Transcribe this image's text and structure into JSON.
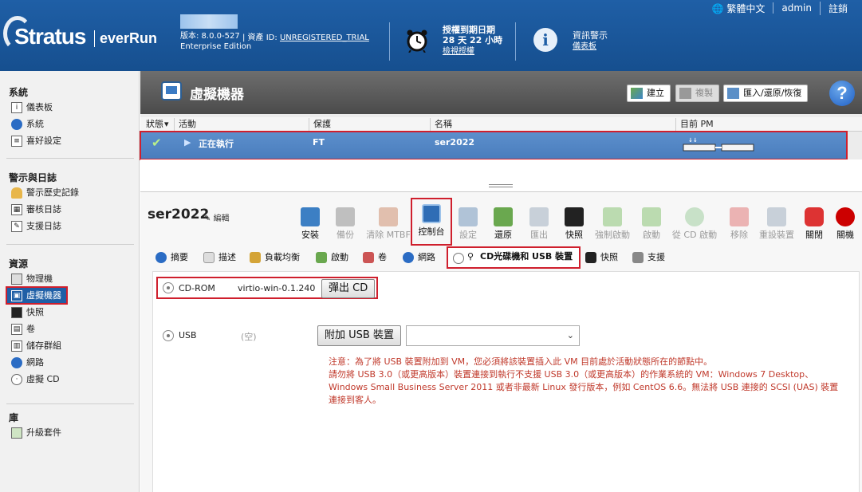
{
  "header": {
    "lang_label": "繁體中文",
    "user_label": "admin",
    "logout_label": "註銷",
    "brand": "Stratus",
    "product": "everRun",
    "version_label": "版本: 8.0.0-527",
    "edition_label": "Enterprise Edition",
    "asset_prefix": "| 資產 ID:",
    "asset_id": "UNREGISTERED_TRIAL",
    "license_title": "授權到期日期",
    "license_remaining": "28 天 22 小時",
    "license_link": "檢視授權",
    "alerts_title": "資訊警示",
    "alerts_link": "儀表板"
  },
  "sidebar": {
    "system_heading": "系統",
    "system_items": [
      {
        "label": "儀表板",
        "icon": "dashboard-icon"
      },
      {
        "label": "系統",
        "icon": "globe-icon"
      },
      {
        "label": "喜好設定",
        "icon": "preferences-icon"
      }
    ],
    "alerts_heading": "警示與日誌",
    "alerts_items": [
      {
        "label": "警示歷史記錄",
        "icon": "bell-icon"
      },
      {
        "label": "審核日誌",
        "icon": "calendar-icon"
      },
      {
        "label": "支援日誌",
        "icon": "log-icon"
      }
    ],
    "resources_heading": "資源",
    "resources_items": [
      {
        "label": "物理機",
        "icon": "server-icon"
      },
      {
        "label": "虛擬機器",
        "icon": "vm-icon"
      },
      {
        "label": "快照",
        "icon": "camera-icon"
      },
      {
        "label": "卷",
        "icon": "volume-icon"
      },
      {
        "label": "儲存群組",
        "icon": "storage-icon"
      },
      {
        "label": "網路",
        "icon": "network-icon"
      },
      {
        "label": "虛擬 CD",
        "icon": "cd-icon"
      }
    ],
    "library_heading": "庫",
    "library_items": [
      {
        "label": "升級套件",
        "icon": "upgrade-icon"
      }
    ]
  },
  "page": {
    "title": "虛擬機器",
    "create_label": "建立",
    "copy_label": "複製",
    "import_label": "匯入/還原/恢復",
    "help_label": "?"
  },
  "grid": {
    "headers": [
      "狀態",
      "活動",
      "保護",
      "名稱",
      "目前 PM"
    ],
    "row": {
      "activity": "正在執行",
      "protection": "FT",
      "name": "ser2022"
    }
  },
  "detail": {
    "vm_name": "ser2022",
    "edit_label": "編輯",
    "actions": [
      {
        "label": "安裝",
        "enabled": true
      },
      {
        "label": "備份",
        "enabled": false
      },
      {
        "label": "清除 MTBF",
        "enabled": false
      },
      {
        "label": "控制台",
        "enabled": true
      },
      {
        "label": "設定",
        "enabled": false
      },
      {
        "label": "還原",
        "enabled": true
      },
      {
        "label": "匯出",
        "enabled": false
      },
      {
        "label": "快照",
        "enabled": true
      },
      {
        "label": "強制啟動",
        "enabled": false
      },
      {
        "label": "啟動",
        "enabled": false
      },
      {
        "label": "從 CD 啟動",
        "enabled": false
      },
      {
        "label": "移除",
        "enabled": false
      },
      {
        "label": "重設裝置",
        "enabled": false
      },
      {
        "label": "關閉",
        "enabled": true
      },
      {
        "label": "關機",
        "enabled": true
      }
    ],
    "tabs": [
      {
        "label": "摘要"
      },
      {
        "label": "描述"
      },
      {
        "label": "負載均衡"
      },
      {
        "label": "啟動"
      },
      {
        "label": "卷"
      },
      {
        "label": "網路"
      },
      {
        "label": "CD光碟機和 USB 裝置"
      },
      {
        "label": "快照"
      },
      {
        "label": "支援"
      }
    ],
    "cdrom": {
      "label": "CD-ROM",
      "value": "virtio-win-0.1.240",
      "eject_label": "彈出 CD"
    },
    "usb": {
      "label": "USB",
      "value": "(空)",
      "attach_label": "附加 USB 裝置",
      "select_value": ""
    },
    "note_lines": [
      "注意：為了將 USB 裝置附加到 VM，您必須將該裝置插入此 VM 目前處於活動狀態所在的節點中。",
      "請勿將 USB 3.0（或更高版本）裝置連接到執行不支援 USB 3.0（或更高版本）的作業系統的 VM：Windows 7 Desktop、",
      "Windows Small Business Server 2011 或者非最新 Linux 發行版本，例如 CentOS 6.6。無法將 USB 連接的 SCSI (UAS) 裝置",
      "連接到客人。"
    ]
  },
  "colors": {
    "header_blue": "#1f5fa6",
    "highlight_red": "#cf1f2d",
    "note_red": "#c0392b",
    "row_blue": "#5c8fcc"
  }
}
